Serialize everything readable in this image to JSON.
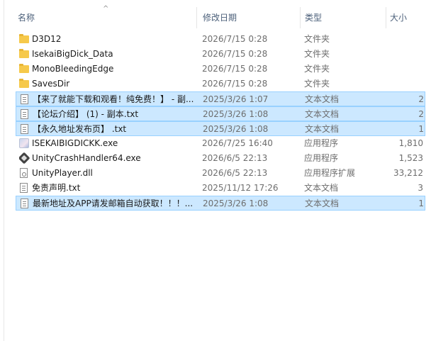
{
  "header": {
    "sort_arrow": "^",
    "name": "名称",
    "date": "修改日期",
    "type": "类型",
    "size": "大小"
  },
  "files": [
    {
      "name": "D3D12",
      "date": "2026/7/15 0:28",
      "type": "文件夹",
      "size": "",
      "icon": "folder-icon",
      "selected": false
    },
    {
      "name": "IsekaiBigDick_Data",
      "date": "2026/7/15 0:28",
      "type": "文件夹",
      "size": "",
      "icon": "folder-icon",
      "selected": false
    },
    {
      "name": "MonoBleedingEdge",
      "date": "2026/7/15 0:28",
      "type": "文件夹",
      "size": "",
      "icon": "folder-icon",
      "selected": false
    },
    {
      "name": "SavesDir",
      "date": "2026/7/15 0:28",
      "type": "文件夹",
      "size": "",
      "icon": "folder-icon",
      "selected": false
    },
    {
      "name": "【来了就能下载和观看！纯免费！】 - 副...",
      "date": "2025/3/26 1:07",
      "type": "文本文档",
      "size": "2",
      "icon": "text-file-icon",
      "selected": true
    },
    {
      "name": "【论坛介绍】 (1) - 副本.txt",
      "date": "2025/3/26 1:08",
      "type": "文本文档",
      "size": "2",
      "icon": "text-file-icon",
      "selected": true
    },
    {
      "name": "【永久地址发布页】 .txt",
      "date": "2025/3/26 1:08",
      "type": "文本文档",
      "size": "1",
      "icon": "text-file-icon",
      "selected": true
    },
    {
      "name": "ISEKAIBIGDICKK.exe",
      "date": "2026/7/25 16:40",
      "type": "应用程序",
      "size": "1,810",
      "icon": "app-image-icon",
      "selected": false
    },
    {
      "name": "UnityCrashHandler64.exe",
      "date": "2026/6/5 22:13",
      "type": "应用程序",
      "size": "1,523",
      "icon": "unity-icon",
      "selected": false
    },
    {
      "name": "UnityPlayer.dll",
      "date": "2026/6/5 22:13",
      "type": "应用程序扩展",
      "size": "33,212",
      "icon": "dll-file-icon",
      "selected": false
    },
    {
      "name": "免责声明.txt",
      "date": "2025/11/12 17:26",
      "type": "文本文档",
      "size": "3",
      "icon": "text-file-icon",
      "selected": false
    },
    {
      "name": "最新地址及APP请发邮箱自动获取！！！...",
      "date": "2025/3/26 1:08",
      "type": "文本文档",
      "size": "1",
      "icon": "text-file-icon",
      "selected": true
    }
  ],
  "colors": {
    "selection_bg": "#cce8ff",
    "selection_border": "#99d1ff",
    "header_text": "#4c607a",
    "secondary_text": "#6d6d6d"
  }
}
